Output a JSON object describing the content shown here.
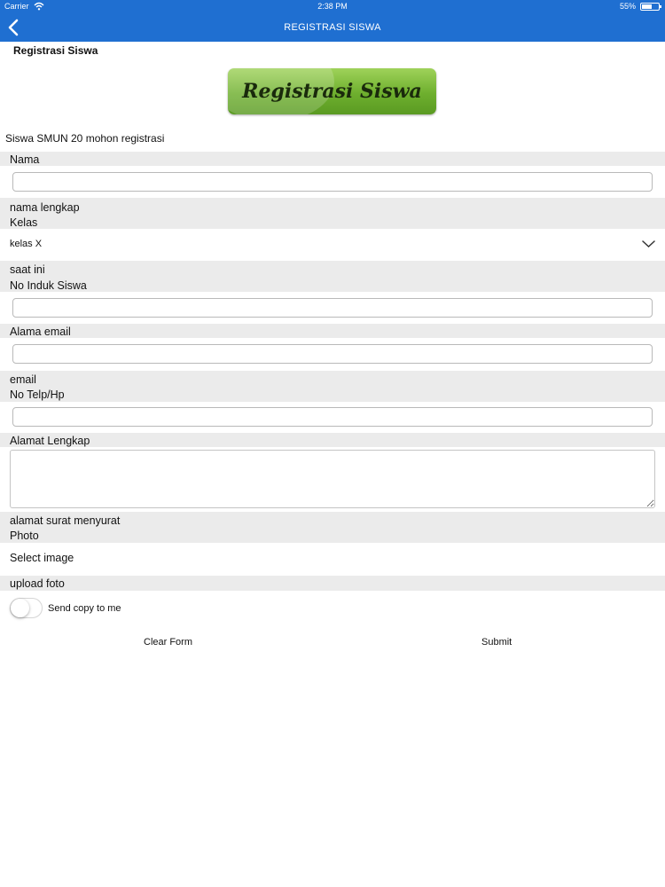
{
  "status_bar": {
    "carrier": "Carrier",
    "time": "2:38 PM",
    "battery": "55%"
  },
  "nav": {
    "title": "REGISTRASI SISWA"
  },
  "page": {
    "heading": "Registrasi Siswa",
    "banner_text": "Registrasi Siswa",
    "intro": "Siswa SMUN 20 mohon registrasi"
  },
  "form": {
    "nama_label": "Nama",
    "nama_hint": "nama lengkap",
    "kelas_label": "Kelas",
    "kelas_value": "kelas X",
    "kelas_hint": "saat ini",
    "nis_label": "No Induk Siswa",
    "email_label": "Alama email",
    "email_hint": "email",
    "telp_label": "No Telp/Hp",
    "alamat_label": "Alamat Lengkap",
    "alamat_hint": "alamat surat menyurat",
    "photo_label": "Photo",
    "select_image": "Select image",
    "photo_hint": "upload foto",
    "copy_label": "Send copy to me"
  },
  "buttons": {
    "clear": "Clear Form",
    "submit": "Submit"
  },
  "colors": {
    "navbar": "#1f6fd1",
    "band": "#ebebeb",
    "banner_green": "#6eaf2e"
  }
}
